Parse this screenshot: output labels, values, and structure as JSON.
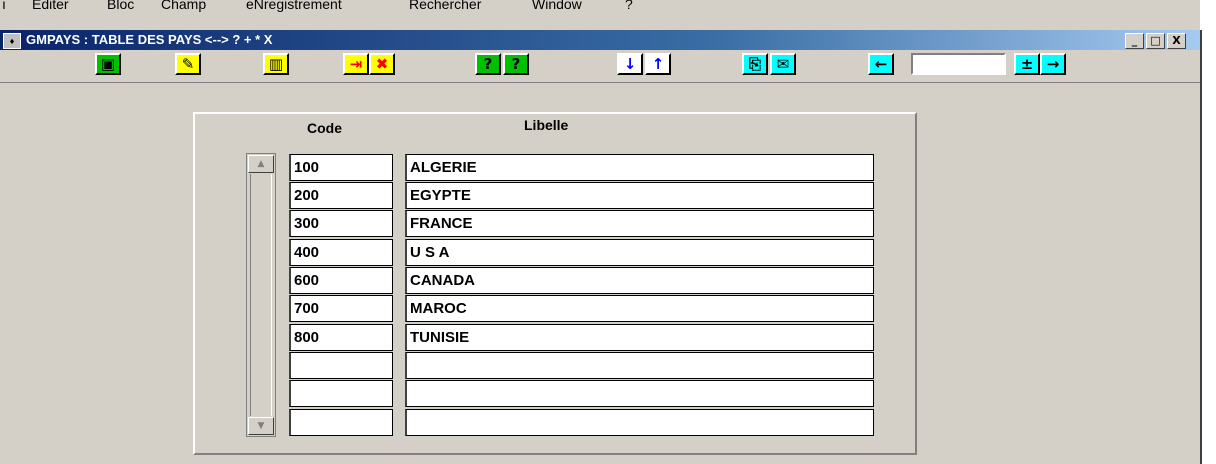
{
  "menu": {
    "items": [
      "ı",
      "Editer",
      "Bloc",
      "Champ",
      "eNregistrement",
      "Rechercher",
      "Window",
      "?"
    ]
  },
  "window": {
    "title": "GMPAYS : TABLE DES PAYS <--> ? + * X",
    "buttons": [
      "_",
      "□",
      "X"
    ]
  },
  "toolbar": {
    "buttons": [
      {
        "name": "save-icon",
        "glyph": "▣",
        "style": "green"
      },
      {
        "name": "help-bubble-icon",
        "glyph": "✎",
        "style": "yellow"
      },
      {
        "name": "trash-icon",
        "glyph": "▥",
        "style": "yellow"
      },
      {
        "name": "insert-record-icon",
        "glyph": "⇥",
        "style": "red"
      },
      {
        "name": "delete-record-icon",
        "glyph": "✖",
        "style": "red"
      },
      {
        "name": "query-enter-icon",
        "glyph": "?",
        "style": "green"
      },
      {
        "name": "query-execute-icon",
        "glyph": "?",
        "style": "green"
      },
      {
        "name": "next-record-icon",
        "glyph": "↓",
        "style": "blue"
      },
      {
        "name": "previous-record-icon",
        "glyph": "↑",
        "style": "blue"
      },
      {
        "name": "print-icon",
        "glyph": "⎘",
        "style": "cyan"
      },
      {
        "name": "export-icon",
        "glyph": "✉",
        "style": "cyan"
      },
      {
        "name": "back-arrow-icon",
        "glyph": "←",
        "style": "cyan"
      },
      {
        "name": "go-icon",
        "glyph": "±",
        "style": "cyan"
      },
      {
        "name": "forward-arrow-icon",
        "glyph": "→",
        "style": "cyan"
      }
    ],
    "input_value": ""
  },
  "table": {
    "headers": {
      "code": "Code",
      "libelle": "Libelle"
    },
    "rows": [
      {
        "code": "100",
        "libelle": "ALGERIE"
      },
      {
        "code": "200",
        "libelle": "EGYPTE"
      },
      {
        "code": "300",
        "libelle": "FRANCE"
      },
      {
        "code": "400",
        "libelle": "U S A"
      },
      {
        "code": "600",
        "libelle": "CANADA"
      },
      {
        "code": "700",
        "libelle": "MAROC"
      },
      {
        "code": "800",
        "libelle": "TUNISIE"
      },
      {
        "code": "",
        "libelle": ""
      },
      {
        "code": "",
        "libelle": ""
      },
      {
        "code": "",
        "libelle": ""
      }
    ]
  },
  "scrollbar": {
    "up": "▲",
    "down": "▼"
  }
}
